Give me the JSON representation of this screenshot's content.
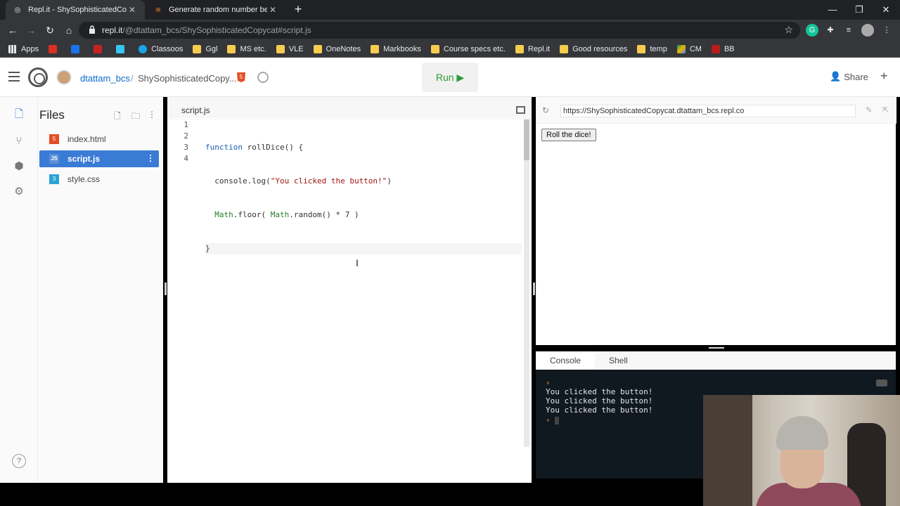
{
  "browser": {
    "tabs": [
      {
        "title": "Repl.it - ShySophisticatedCopyca",
        "active": true
      },
      {
        "title": "Generate random number betwe",
        "active": false
      }
    ],
    "url_host": "repl.it",
    "url_path": "/@dtattam_bcs/ShySophisticatedCopycat#script.js",
    "bookmarks": [
      "Apps",
      "Classoos",
      "Ggl",
      "MS etc.",
      "VLE",
      "OneNotes",
      "Markbooks",
      "Course specs etc.",
      "Repl.it",
      "Good resources",
      "temp",
      "CM",
      "BB"
    ]
  },
  "header": {
    "owner": "dtattam_bcs",
    "separator": "/",
    "repl_name": "ShySophisticatedCopy...",
    "run_label": "Run ▶",
    "share_label": "Share"
  },
  "files": {
    "title": "Files",
    "items": [
      {
        "name": "index.html",
        "type": "html",
        "selected": false
      },
      {
        "name": "script.js",
        "type": "js",
        "selected": true
      },
      {
        "name": "style.css",
        "type": "css",
        "selected": false
      }
    ]
  },
  "editor": {
    "tab": "script.js",
    "line_numbers": [
      "1",
      "2",
      "3",
      "4"
    ]
  },
  "webview": {
    "url": "https://ShySophisticatedCopycat.dtattam_bcs.repl.co",
    "button_label": "Roll the dice!"
  },
  "console": {
    "tabs": [
      "Console",
      "Shell"
    ],
    "lines": [
      "You clicked the button!",
      "You clicked the button!",
      "You clicked the button!"
    ]
  },
  "colors": {
    "accent": "#3a7bd5",
    "run_green": "#2e9b39",
    "console_bg": "#101820"
  }
}
